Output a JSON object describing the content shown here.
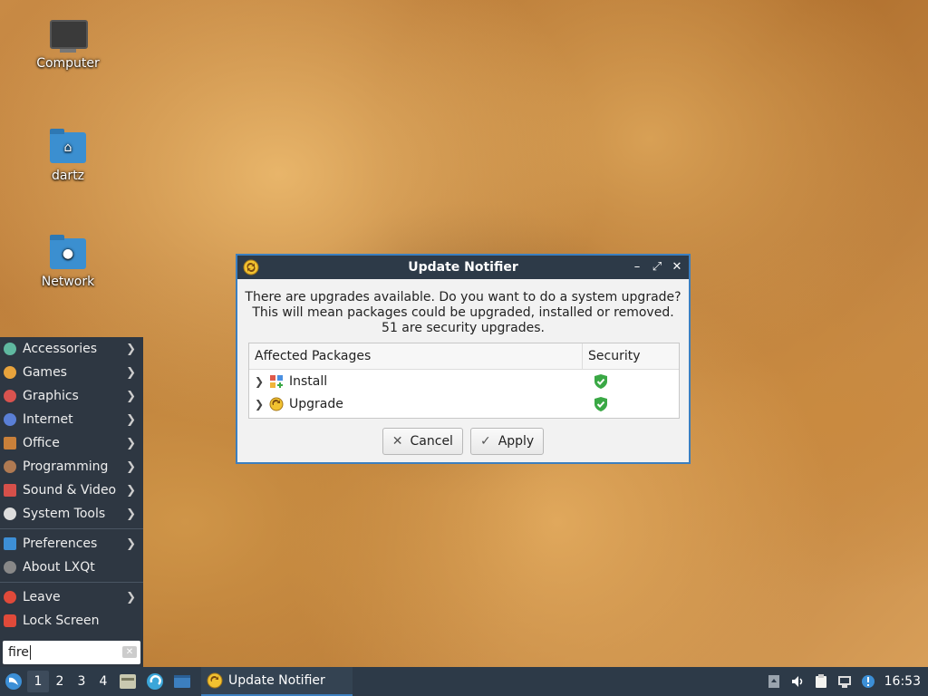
{
  "desktop": {
    "icons": [
      {
        "label": "Computer",
        "icon": "computer-icon"
      },
      {
        "label": "dartz",
        "icon": "home-folder-icon"
      },
      {
        "label": "Network",
        "icon": "network-folder-icon"
      }
    ]
  },
  "dialog": {
    "title": "Update Notifier",
    "message_line1": "There are upgrades available. Do you want to do a system upgrade?",
    "message_line2": "This will mean packages could be upgraded, installed or removed.",
    "message_line3": "51 are security upgrades.",
    "columns": [
      "Affected Packages",
      "Security"
    ],
    "rows": [
      {
        "name": "Install",
        "icon": "install-icon",
        "security": "shield-check-icon"
      },
      {
        "name": "Upgrade",
        "icon": "upgrade-icon",
        "security": "shield-check-icon"
      }
    ],
    "cancel_label": "Cancel",
    "apply_label": "Apply"
  },
  "menu": {
    "items": [
      {
        "label": "Accessories",
        "color": "#5fb8a0"
      },
      {
        "label": "Games",
        "color": "#e8a33c"
      },
      {
        "label": "Graphics",
        "color": "#d9534f"
      },
      {
        "label": "Internet",
        "color": "#5a7fd6"
      },
      {
        "label": "Office",
        "color": "#c9803a"
      },
      {
        "label": "Programming",
        "color": "#b07a52"
      },
      {
        "label": "Sound & Video",
        "color": "#d6504a"
      },
      {
        "label": "System Tools",
        "color": "#dddddd"
      },
      {
        "label": "Preferences",
        "color": "#3d8fd6"
      },
      {
        "label": "About LXQt",
        "color": "#888888"
      },
      {
        "label": "Leave",
        "color": "#e04a3a"
      },
      {
        "label": "Lock Screen",
        "color": "#e04a3a"
      }
    ],
    "search_value": "fire"
  },
  "taskbar": {
    "desktops": [
      "1",
      "2",
      "3",
      "4"
    ],
    "task_label": "Update Notifier",
    "clock": "16:53"
  },
  "colors": {
    "titlebar": "#2d3a48",
    "accent": "#3c7fbf",
    "shield": "#3aa845"
  }
}
